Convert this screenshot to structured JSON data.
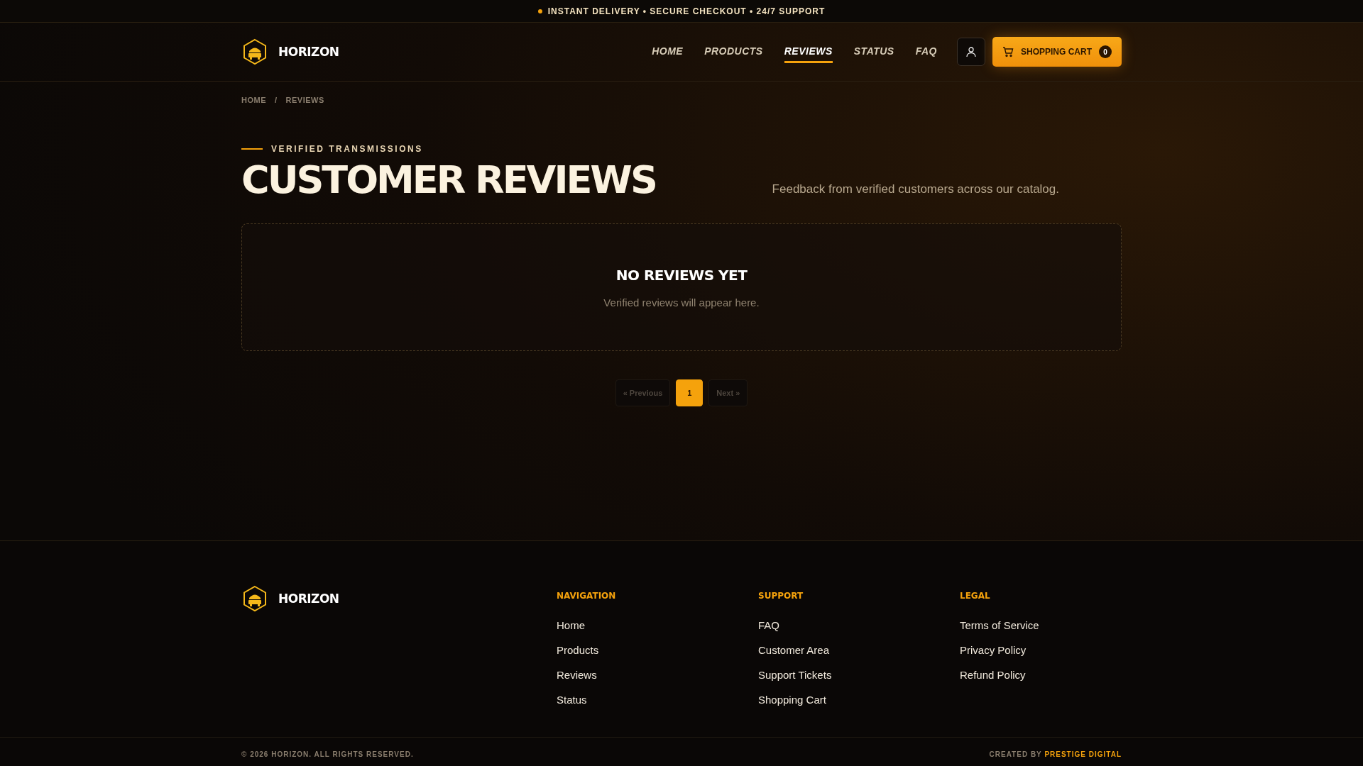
{
  "announcement": "INSTANT DELIVERY • SECURE CHECKOUT • 24/7 SUPPORT",
  "brand": "HORIZON",
  "nav": [
    {
      "label": "HOME",
      "selected": false
    },
    {
      "label": "PRODUCTS",
      "selected": false
    },
    {
      "label": "REVIEWS",
      "selected": true
    },
    {
      "label": "STATUS",
      "selected": false
    },
    {
      "label": "FAQ",
      "selected": false
    }
  ],
  "cart": {
    "label": "SHOPPING CART",
    "count": "0"
  },
  "breadcrumb": [
    "HOME",
    "/",
    "REVIEWS"
  ],
  "eyebrow": "VERIFIED TRANSMISSIONS",
  "title": "CUSTOMER REVIEWS",
  "subtitle": "Feedback from verified customers across our catalog.",
  "empty": {
    "title": "NO REVIEWS YET",
    "text": "Verified reviews will appear here."
  },
  "pagination": [
    {
      "label": "« Previous",
      "selected": false,
      "disabled": true
    },
    {
      "label": "1",
      "selected": true,
      "disabled": false
    },
    {
      "label": "Next »",
      "selected": false,
      "disabled": true
    }
  ],
  "footer": {
    "brand": "HORIZON",
    "columns": [
      {
        "heading": "NAVIGATION",
        "links": [
          "Home",
          "Products",
          "Reviews",
          "Status"
        ]
      },
      {
        "heading": "SUPPORT",
        "links": [
          "FAQ",
          "Customer Area",
          "Support Tickets",
          "Shopping Cart"
        ]
      },
      {
        "heading": "LEGAL",
        "links": [
          "Terms of Service",
          "Privacy Policy",
          "Refund Policy"
        ]
      }
    ]
  },
  "copyright": "© 2026 HORIZON. ALL RIGHTS RESERVED.",
  "credit": {
    "prefix": "CREATED BY",
    "name": "PRESTIGE DIGITAL"
  }
}
